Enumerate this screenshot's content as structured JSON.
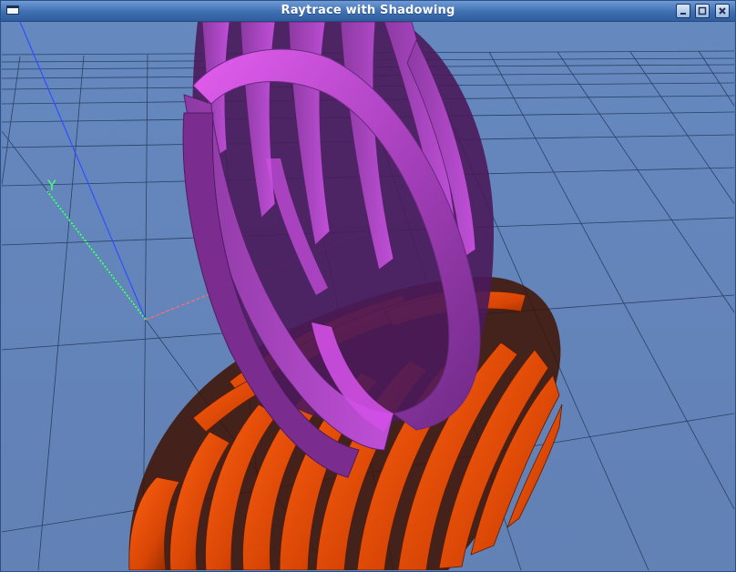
{
  "window": {
    "title": "Raytrace with Shadowing"
  },
  "scene": {
    "axis_label_y": "Y",
    "background_color": "#6283b8",
    "grid_color": "#1b2f4d",
    "axis_colors": {
      "x": "#ff7070",
      "y": "#44ff7a",
      "z": "#2f4fff"
    },
    "object_colors": {
      "magenta_torus": "#c44ad6",
      "orange_torus": "#e84a06"
    }
  },
  "icons": [
    "window-menu-icon",
    "minimize-icon",
    "maximize-icon",
    "close-icon"
  ]
}
